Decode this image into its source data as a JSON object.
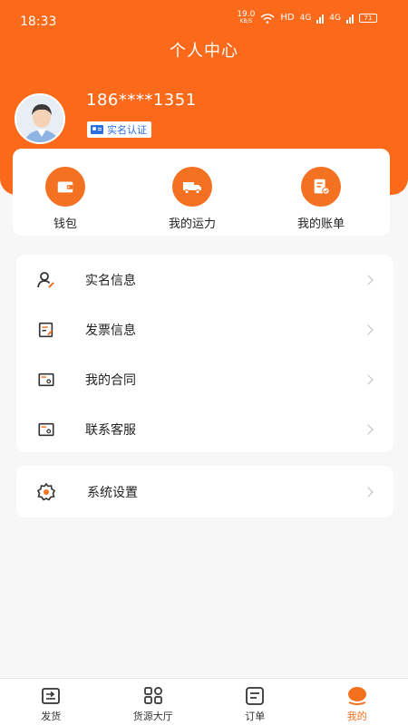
{
  "status_bar": {
    "time": "18:33",
    "net_speed": "19.0",
    "net_unit": "KB/S",
    "hd": "HD",
    "signal1": "4G",
    "signal2": "4G",
    "battery": "71"
  },
  "header": {
    "title": "个人中心"
  },
  "profile": {
    "phone": "186****1351",
    "verify_label": "实名认证"
  },
  "quick_actions": [
    {
      "label": "钱包",
      "icon": "wallet-icon"
    },
    {
      "label": "我的运力",
      "icon": "truck-icon"
    },
    {
      "label": "我的账单",
      "icon": "bill-icon"
    }
  ],
  "menu": [
    {
      "label": "实名信息",
      "icon": "user-edit-icon"
    },
    {
      "label": "发票信息",
      "icon": "invoice-icon"
    },
    {
      "label": "我的合同",
      "icon": "contract-icon"
    },
    {
      "label": "联系客服",
      "icon": "service-icon"
    }
  ],
  "settings": {
    "label": "系统设置",
    "icon": "gear-icon"
  },
  "tabs": [
    {
      "label": "发货",
      "icon": "ship-icon"
    },
    {
      "label": "货源大厅",
      "icon": "grid-icon"
    },
    {
      "label": "订单",
      "icon": "order-icon"
    },
    {
      "label": "我的",
      "icon": "profile-icon",
      "active": true
    }
  ],
  "colors": {
    "accent": "#fb6a1a",
    "verify_blue": "#2e6fe0"
  }
}
